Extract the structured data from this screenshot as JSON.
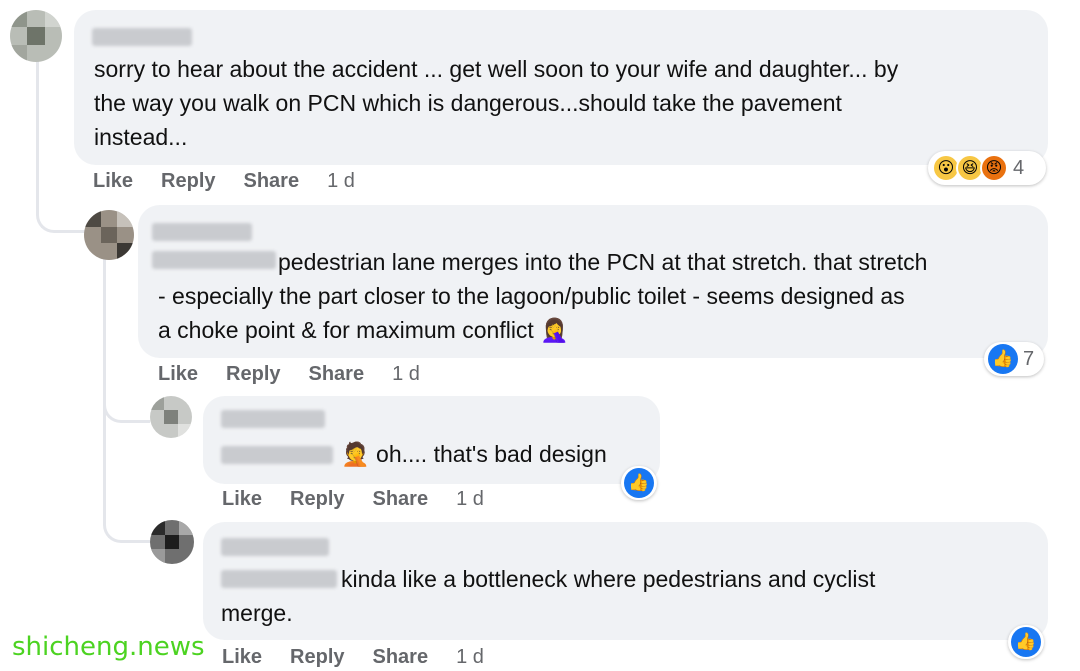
{
  "comments": [
    {
      "text_lines": [
        "sorry to hear about the accident ... get well soon to your wife and daughter... by",
        "the way you walk on PCN which is dangerous...should take the pavement",
        "instead..."
      ],
      "actions": {
        "like": "Like",
        "reply": "Reply",
        "share": "Share",
        "time": "1 d"
      },
      "reactions": {
        "icons": [
          "wow-emoji-icon",
          "haha-emoji-icon",
          "angry-emoji-icon"
        ],
        "count": "4"
      }
    },
    {
      "text_lines": [
        "pedestrian lane merges into the PCN at that stretch. that stretch",
        "- especially the part closer to the lagoon/public toilet - seems designed as",
        "a choke point & for maximum conflict"
      ],
      "trailing_emoji": "🤦‍♀️",
      "actions": {
        "like": "Like",
        "reply": "Reply",
        "share": "Share",
        "time": "1 d"
      },
      "reactions": {
        "icons": [
          "like-icon"
        ],
        "count": "7"
      }
    },
    {
      "lead_emoji": "🤦",
      "text_lines": [
        "oh.... that's bad design"
      ],
      "actions": {
        "like": "Like",
        "reply": "Reply",
        "share": "Share",
        "time": "1 d"
      },
      "reactions": {
        "icons": [
          "like-icon"
        ],
        "count": ""
      }
    },
    {
      "text_lines": [
        "kinda like a bottleneck where pedestrians and cyclist",
        "merge."
      ],
      "actions": {
        "like": "Like",
        "reply": "Reply",
        "share": "Share",
        "time": "1 d"
      },
      "reactions": {
        "icons": [
          "like-icon"
        ],
        "count": ""
      }
    }
  ],
  "watermark": "shicheng.news",
  "colors": {
    "bubble": "#f0f2f5",
    "like_blue": "#1877f2",
    "meta_gray": "#65676b"
  }
}
